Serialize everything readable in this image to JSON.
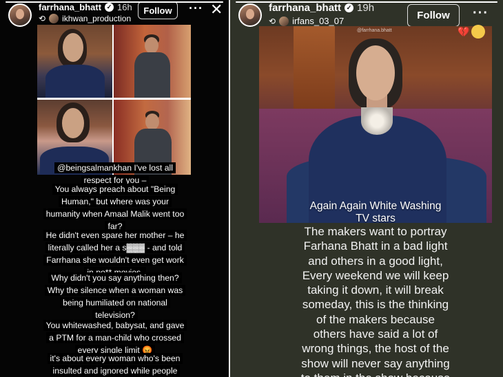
{
  "left_story": {
    "progress_fraction": 1.0,
    "username": "farrhana_bhatt",
    "time": "16h",
    "reposted_from": "ikhwan_production",
    "follow_label": "Follow",
    "more_glyph": "···",
    "close_glyph": "✕",
    "captions": [
      "@beingsalmankhan I've lost all respect for you –",
      "You always preach about \"Being Human,\" but where was your humanity when Amaal Malik went too far?",
      "He didn't even spare her mother – he literally called her a s▓▓▓ - and told Farrhana she wouldn't even get work in po** movies.",
      "Why didn't you say anything then? Why the silence when a woman was being humiliated on national television?",
      "You whitewashed, babysat, and gave a PTM for a man-child who crossed every single limit 😡",
      "it's about every woman who's been insulted and ignored while people like"
    ]
  },
  "right_story": {
    "progress_fraction": 1.0,
    "username": "farrhana_bhatt",
    "time": "19h",
    "reposted_from": "irfans_03_07",
    "follow_label": "Follow",
    "more_glyph": "···",
    "watermark": "@farrhana.bhatt",
    "emojis": [
      "💔",
      "🥺"
    ],
    "image_caption": [
      "Again Again White Washing",
      "TV stars"
    ],
    "body_lines": [
      "The makers want to portray",
      "Farhana Bhatt in a bad light",
      "and others in a good light,",
      "Every weekend we will keep",
      "taking it down, it will break",
      "someday, this is the thinking",
      "of the makers because",
      "others have said a lot of",
      "wrong things, the host of the",
      "show will never say anything",
      "to them in the show because"
    ]
  },
  "colors": {
    "left_bg": "#050505",
    "right_bg": "#2f3228",
    "caption_bg": "#000000",
    "text": "#ffffff"
  },
  "icons": [
    "verified-badge-icon",
    "repost-icon",
    "more-options-icon",
    "close-icon"
  ]
}
